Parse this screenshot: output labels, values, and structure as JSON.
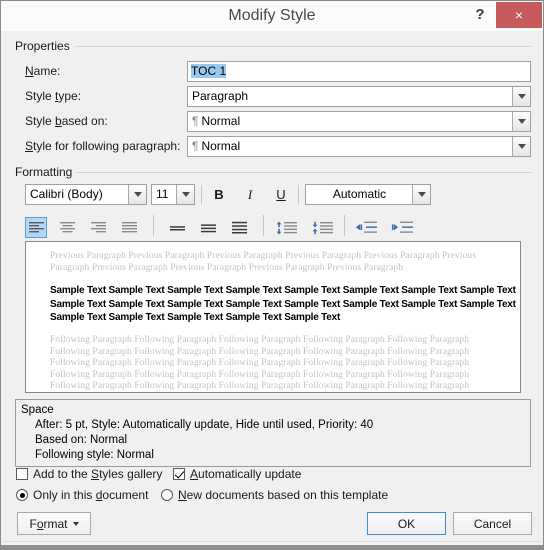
{
  "window": {
    "title": "Modify Style",
    "help_icon": "?",
    "close_icon": "×"
  },
  "properties": {
    "group_label": "Properties",
    "name": {
      "label_pre": "",
      "label_key": "N",
      "label_post": "ame:",
      "value": "TOC 1"
    },
    "style_type": {
      "label_pre": "Style ",
      "label_key": "t",
      "label_post": "ype:",
      "value": "Paragraph"
    },
    "style_based_on": {
      "label_pre": "Style ",
      "label_key": "b",
      "label_post": "ased on:",
      "pilcrow": "¶",
      "value": "Normal"
    },
    "style_following": {
      "label_pre": "",
      "label_key": "S",
      "label_post": "tyle for following paragraph:",
      "pilcrow": "¶",
      "value": "Normal"
    }
  },
  "formatting": {
    "group_label": "Formatting",
    "font_family": "Calibri (Body)",
    "font_size": "11",
    "bold_label": "B",
    "italic_label": "I",
    "underline_label": "U",
    "font_color": "Automatic",
    "align_buttons": [
      {
        "name": "align-left",
        "selected": true
      },
      {
        "name": "align-center",
        "selected": false
      },
      {
        "name": "align-right",
        "selected": false
      },
      {
        "name": "align-justify",
        "selected": false
      }
    ],
    "linespacing_buttons": [
      {
        "name": "line-spacing-single"
      },
      {
        "name": "line-spacing-1-5"
      },
      {
        "name": "line-spacing-double"
      }
    ],
    "paragraph_space_buttons": [
      {
        "name": "decrease-paragraph-spacing"
      },
      {
        "name": "increase-paragraph-spacing"
      }
    ],
    "indent_buttons": [
      {
        "name": "decrease-indent"
      },
      {
        "name": "increase-indent"
      }
    ]
  },
  "preview": {
    "previous_paragraph_lines": [
      "Previous Paragraph Previous Paragraph Previous Paragraph Previous Paragraph Previous Paragraph Previous",
      "Paragraph Previous Paragraph Previous Paragraph Previous Paragraph Previous Paragraph"
    ],
    "sample_lines": [
      "Sample Text Sample Text Sample Text Sample Text Sample Text Sample Text Sample Text Sample Text",
      "Sample Text Sample Text Sample Text Sample Text Sample Text Sample Text Sample Text Sample Text",
      "Sample Text Sample Text Sample Text Sample Text Sample Text"
    ],
    "following_paragraph_lines": [
      "Following Paragraph Following Paragraph Following Paragraph Following Paragraph Following Paragraph",
      "Following Paragraph Following Paragraph Following Paragraph Following Paragraph Following Paragraph",
      "Following Paragraph Following Paragraph Following Paragraph Following Paragraph Following Paragraph",
      "Following Paragraph Following Paragraph Following Paragraph Following Paragraph Following Paragraph",
      "Following Paragraph Following Paragraph Following Paragraph Following Paragraph Following Paragraph"
    ]
  },
  "description": {
    "line1": "Space",
    "line2": "After:  5 pt, Style: Automatically update, Hide until used, Priority: 40",
    "line3": "Based on: Normal",
    "line4": "Following style: Normal"
  },
  "options": {
    "add_to_gallery": {
      "label_pre": "Add to the ",
      "label_key": "S",
      "label_post": "tyles gallery",
      "checked": false
    },
    "automatically_update": {
      "label_pre": "",
      "label_key": "A",
      "label_post": "utomatically update",
      "checked": true
    },
    "only_this_document": {
      "label_pre": "Only in this ",
      "label_key": "d",
      "label_post": "ocument",
      "checked": true
    },
    "new_documents": {
      "label_pre": "",
      "label_key": "N",
      "label_post": "ew documents based on this template",
      "checked": false
    }
  },
  "footer": {
    "format_pre": "F",
    "format_key": "o",
    "format_post": "rmat",
    "ok": "OK",
    "cancel": "Cancel"
  },
  "colors": {
    "accent_blue": "#3a8ed8",
    "selection_blue": "#99c9ef",
    "close_red": "#c75b5b",
    "toolbar_icon_blue": "#3f6fa8",
    "dialog_bg": "#f0f0f0"
  }
}
